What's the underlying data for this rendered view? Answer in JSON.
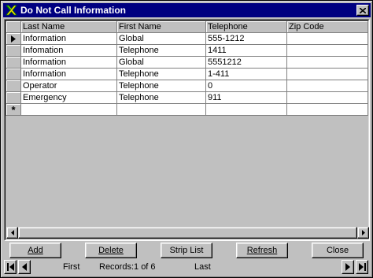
{
  "window": {
    "title": "Do Not Call Information",
    "icon": "x-app-icon"
  },
  "grid": {
    "columns": [
      "Last Name",
      "First Name",
      "Telephone",
      "Zip Code"
    ],
    "rows": [
      [
        "Information",
        "Global",
        "555-1212",
        ""
      ],
      [
        "Infomation",
        "Telephone",
        "1411",
        ""
      ],
      [
        "Information",
        "Global",
        "5551212",
        ""
      ],
      [
        "Information",
        "Telephone",
        "1-411",
        ""
      ],
      [
        "Operator",
        "Telephone",
        "0",
        ""
      ],
      [
        "Emergency",
        "Telephone",
        "911",
        ""
      ]
    ],
    "current_row_indicator": "triangle-right-icon",
    "new_row_indicator": "asterisk-icon",
    "new_row_glyph": "*"
  },
  "buttons": {
    "add": "Add",
    "delete": "Delete",
    "strip_list": "Strip List",
    "refresh": "Refresh",
    "close": "Close"
  },
  "navigation": {
    "first_label": "First",
    "records_label": "Records:1 of 6",
    "last_label": "Last"
  }
}
